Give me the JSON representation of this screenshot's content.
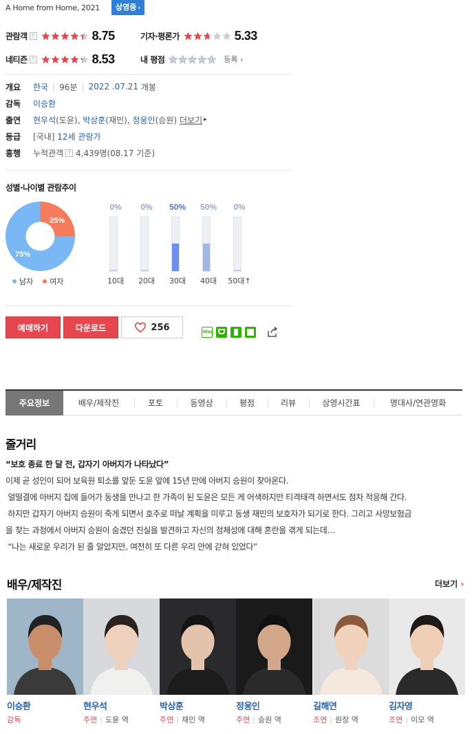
{
  "movie": {
    "title_en": "A Home from Home, 2021",
    "status": "상영중"
  },
  "ratings": {
    "audience": {
      "label": "관람객",
      "score": "8.75",
      "stars": 4.4
    },
    "critic": {
      "label": "기자·평론가",
      "score": "5.33",
      "stars": 2.7
    },
    "netizen": {
      "label": "네티즌",
      "score": "8.53",
      "stars": 4.3
    },
    "mine": {
      "label": "내 평점",
      "stars": 0,
      "register": "등록"
    }
  },
  "info": {
    "overview_label": "개요",
    "country": "한국",
    "runtime": "96분",
    "release_date": "2022 .07.21",
    "release_suffix": "개봉",
    "director_label": "감독",
    "director": "이승환",
    "cast_label": "출연",
    "cast_1": "현우석",
    "cast_1_role": "(도윤),",
    "cast_2": "박상훈",
    "cast_2_role": "(재민),",
    "cast_3": "정웅인",
    "cast_3_role": "(승원)",
    "cast_more": "더보기",
    "grade_label": "등급",
    "grade_region": "[국내]",
    "grade": "12세 관람가",
    "boxoffice_label": "흥행",
    "boxoffice_prefix": "누적관객",
    "boxoffice_value": "4,439명(08.17 기준)"
  },
  "demographics": {
    "title": "성별·나이별 관람추이",
    "gender": {
      "male_pct": 75,
      "female_pct": 25,
      "male_label": "75%",
      "female_label": "25%",
      "male_legend": "남자",
      "female_legend": "여자"
    },
    "ages": [
      {
        "label": "10대",
        "pct_text": "0%",
        "pct": 0
      },
      {
        "label": "20대",
        "pct_text": "0%",
        "pct": 0
      },
      {
        "label": "30대",
        "pct_text": "50%",
        "pct": 50
      },
      {
        "label": "40대",
        "pct_text": "50%",
        "pct": 50
      },
      {
        "label": "50대↑",
        "pct_text": "0%",
        "pct": 0
      }
    ]
  },
  "actions": {
    "reserve": "예매하기",
    "download": "다운로드",
    "likes": "256"
  },
  "tabs": [
    "주요정보",
    "배우/제작진",
    "포토",
    "동영상",
    "평점",
    "리뷰",
    "상영시간표",
    "명대사/연관영화"
  ],
  "synopsis": {
    "heading": "줄거리",
    "quote": "“보호 종료 한 달 전, 갑자기 아버지가 나타났다”",
    "line1": "이제 곧 성인이 되어 보육원 퇴소를 앞둔 도윤 앞에 15년 만에 아버지 승원이 찾아온다.",
    "line2": " 얼떨결에 아버지 집에 들어가 동생을 만나고 한 가족이 된 도윤은 모든 게 어색하지만 티격태격 하면서도 점차 적응해 간다.",
    "line3": " 하지만 갑자기 아버지 승원이 죽게 되면서 호주로 떠날 계획을 미루고 동생 재민의 보호자가 되기로 한다. 그리고 사망보험금",
    "line4": "을 찾는 과정에서 아버지 승원이 숨겼던 진실을 발견하고 자신의 정체성에 대해 혼란을 겪게 되는데…",
    "line5": " “나는 새로운 우리가 된 줄 알았지만, 여전히 또 다른 우리 안에 갇혀 있었다”"
  },
  "cast_section": {
    "heading": "배우/제작진",
    "more": "더보기",
    "people": [
      {
        "name": "이승환",
        "role_type": "감독",
        "character": ""
      },
      {
        "name": "현우석",
        "role_type": "주연",
        "character": "도윤 역"
      },
      {
        "name": "박상훈",
        "role_type": "주연",
        "character": "재민 역"
      },
      {
        "name": "정웅인",
        "role_type": "주연",
        "character": "승원 역"
      },
      {
        "name": "길해연",
        "role_type": "조연",
        "character": "원장 역"
      },
      {
        "name": "김자영",
        "role_type": "조연",
        "character": "이모 역"
      }
    ]
  },
  "colors": {
    "accent_red": "#e6474e",
    "link_blue": "#2661b8",
    "badge_blue": "#2f7fd4",
    "male": "#7ab8f5",
    "female": "#f47c5c",
    "bar_blue": "#6f8ff0",
    "bar_light": "#a3b6e6"
  }
}
